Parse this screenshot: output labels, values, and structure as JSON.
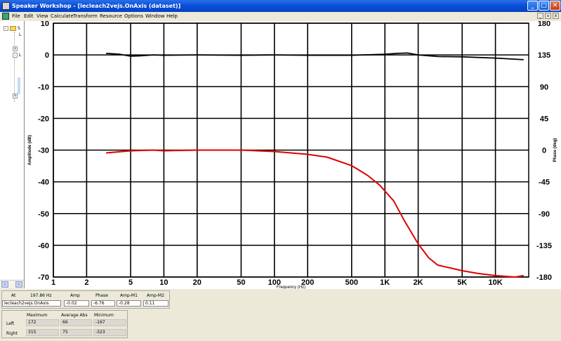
{
  "window": {
    "title": "Speaker Workshop - [lecleach2vejs.OnAxis (dataset)]",
    "app_icon": "speaker-workshop-icon",
    "minimize": "_",
    "maximize": "□",
    "close": "✕"
  },
  "menu": {
    "items": [
      "File",
      "Edit",
      "View",
      "Calculate",
      "Transform",
      "Resource",
      "Options",
      "Window",
      "Help"
    ],
    "doc_minimize": "_",
    "doc_restore": "▫",
    "doc_close": "x"
  },
  "tree": {
    "visible_labels": [
      "S",
      "L",
      "L"
    ]
  },
  "scroll": {
    "left_arrow": "‹",
    "right_arrow": "›"
  },
  "chart_data": {
    "type": "line",
    "xlabel": "Frequency (Hz)",
    "ylabel": "Amplitude (dB)",
    "y2label": "Phase (deg)",
    "x_scale": "log",
    "xlim": [
      1,
      20000
    ],
    "ylim": [
      -70,
      10
    ],
    "y2lim": [
      -180,
      180
    ],
    "x_ticks": [
      1,
      2,
      5,
      10,
      20,
      50,
      100,
      200,
      500,
      1000,
      2000,
      5000,
      10000
    ],
    "x_tick_labels": [
      "1",
      "2",
      "5",
      "10",
      "20",
      "50",
      "100",
      "200",
      "500",
      "1K",
      "2K",
      "5K",
      "10K"
    ],
    "y_ticks": [
      10,
      0,
      -10,
      -20,
      -30,
      -40,
      -50,
      -60,
      -70
    ],
    "y2_ticks": [
      180,
      135,
      90,
      45,
      0,
      -45,
      -90,
      -135,
      -180
    ],
    "grid": true,
    "series": [
      {
        "color": "#000000",
        "axis": "left",
        "x": [
          3,
          4,
          5,
          6,
          8,
          10,
          20,
          50,
          100,
          200,
          500,
          800,
          1000,
          1300,
          1600,
          2000,
          3000,
          5000,
          10000,
          18000
        ],
        "y": [
          0.5,
          0.2,
          -0.4,
          -0.3,
          0,
          -0.1,
          0,
          -0.1,
          0,
          -0.1,
          -0.1,
          0.1,
          0.2,
          0.5,
          0.6,
          0,
          -0.5,
          -0.6,
          -1,
          -1.5
        ]
      },
      {
        "color": "#e00000",
        "axis": "right",
        "x": [
          3,
          5,
          8,
          10,
          20,
          50,
          100,
          200,
          300,
          500,
          700,
          900,
          1000,
          1200,
          1500,
          2000,
          2500,
          3000,
          5000,
          7000,
          10000,
          15000,
          18000
        ],
        "y": [
          -4,
          -1,
          0,
          -1,
          0,
          0,
          -2,
          -6,
          -10,
          -22,
          -36,
          -50,
          -58,
          -72,
          -100,
          -133,
          -153,
          -163,
          -171,
          -175,
          -178,
          -180,
          -178
        ]
      }
    ]
  },
  "status": {
    "at_label": "At",
    "at_value": "197.86 Hz",
    "col_amp": "Amp",
    "col_phase": "Phase",
    "col_ampm1": "Amp-M1",
    "col_ampm2": "Amp-M2",
    "dataset": "lecleach2vejs.OnAxis",
    "amp": "-0.02",
    "phase": "-6.76",
    "ampm1": "-0.28",
    "ampm2": "0.11",
    "col_max": "Maximum",
    "col_avg": "Average Abs",
    "col_min": "Minimum",
    "row_left": "Left",
    "left_max": "172",
    "left_avg": "66",
    "left_min": "-167",
    "row_right": "Right",
    "right_max": "315",
    "right_avg": "75",
    "right_min": "-323"
  }
}
